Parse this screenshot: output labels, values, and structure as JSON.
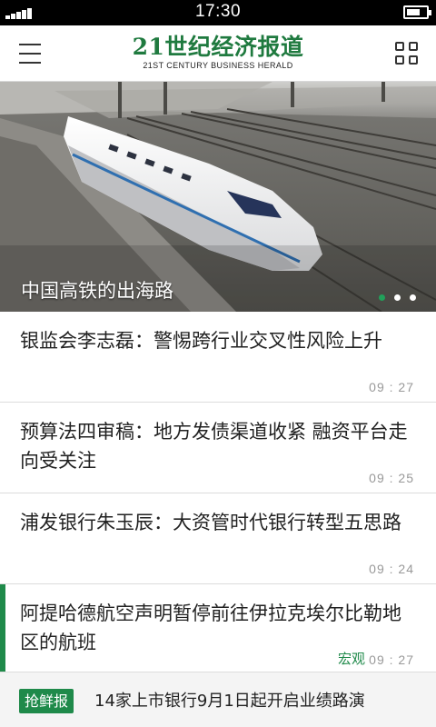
{
  "status_bar": {
    "time": "17:30",
    "icons": {
      "signal": "signal-bars-icon",
      "battery": "battery-icon"
    },
    "battery_level": 0.7
  },
  "header": {
    "logo_cn": "21世纪经济报道",
    "logo_en": "21ST CENTURY BUSINESS HERALD",
    "icons": {
      "menu": "hamburger-menu-icon",
      "grid": "grid-apps-icon"
    }
  },
  "banner": {
    "title": "中国高铁的出海路",
    "slides": 3,
    "active_slide": 1
  },
  "news": [
    {
      "title": "银监会李志磊：警惕跨行业交叉性风险上升",
      "time": "09 : 27",
      "tag": ""
    },
    {
      "title": "预算法四审稿：地方发债渠道收紧  融资平台走向受关注",
      "time": "09 : 25",
      "tag": ""
    },
    {
      "title": "浦发银行朱玉辰：大资管时代银行转型五思路",
      "time": "09 : 24",
      "tag": ""
    },
    {
      "title": "阿提哈德航空声明暂停前往伊拉克埃尔比勒地区的航班",
      "time": "09 : 27",
      "tag": "宏观"
    }
  ],
  "ticker": {
    "badge": "抢鲜报",
    "text": "14家上市银行9月1日起开启业绩路演"
  },
  "colors": {
    "brand_green": "#1f7a3f",
    "accent_green": "#1f8a4a",
    "status_bar": "#000000"
  }
}
